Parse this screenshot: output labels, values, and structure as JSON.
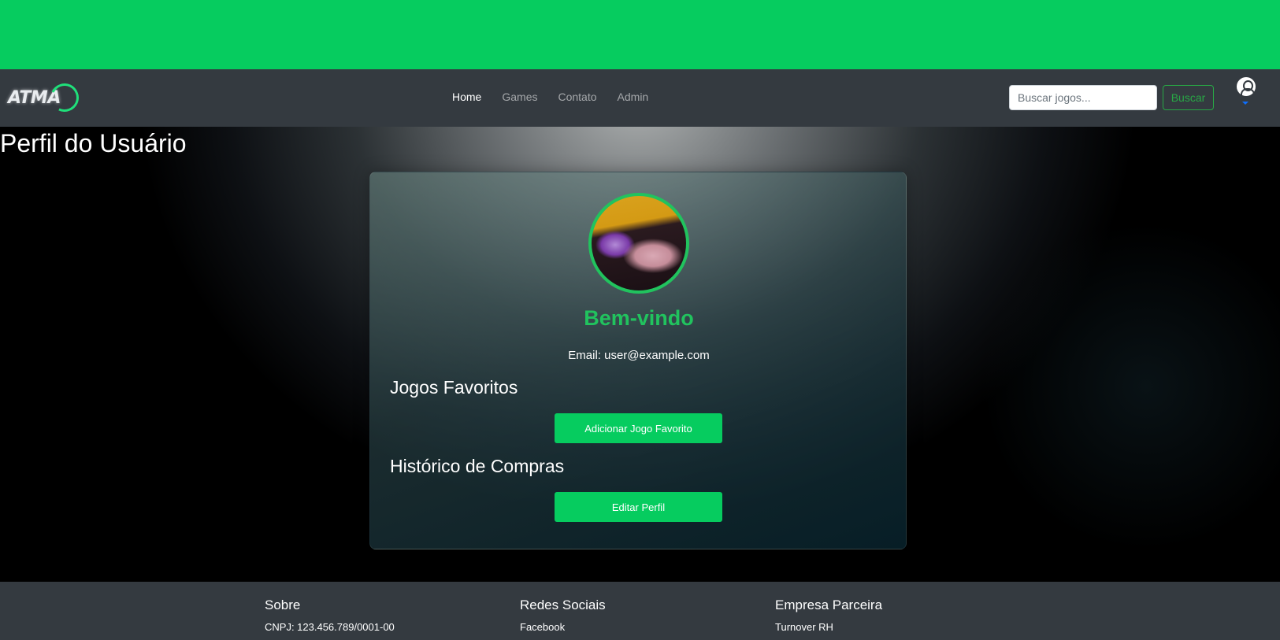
{
  "header": {
    "logo_text": "ATMA",
    "nav": [
      {
        "label": "Home",
        "active": true
      },
      {
        "label": "Games"
      },
      {
        "label": "Contato"
      },
      {
        "label": "Admin"
      }
    ],
    "search": {
      "placeholder": "Buscar jogos...",
      "button_label": "Buscar"
    },
    "colors": {
      "top_band": "#06cc5f",
      "navbar": "#343a40",
      "accent": "#28a745"
    }
  },
  "page": {
    "title": "Perfil do Usuário"
  },
  "profile": {
    "welcome": "Bem-vindo",
    "email": "Email: user@example.com",
    "favorites_heading": "Jogos Favoritos",
    "add_favorite_label": "Adicionar Jogo Favorito",
    "history_heading": "Histórico de Compras",
    "edit_profile_label": "Editar Perfil",
    "colors": {
      "welcome": "#21c35e",
      "button": "#06cc5f"
    }
  },
  "footer": {
    "about": {
      "heading": "Sobre",
      "text": "CNPJ: 123.456.789/0001-00"
    },
    "social": {
      "heading": "Redes Sociais",
      "text": "Facebook"
    },
    "partner": {
      "heading": "Empresa Parceira",
      "text": "Turnover RH"
    }
  }
}
